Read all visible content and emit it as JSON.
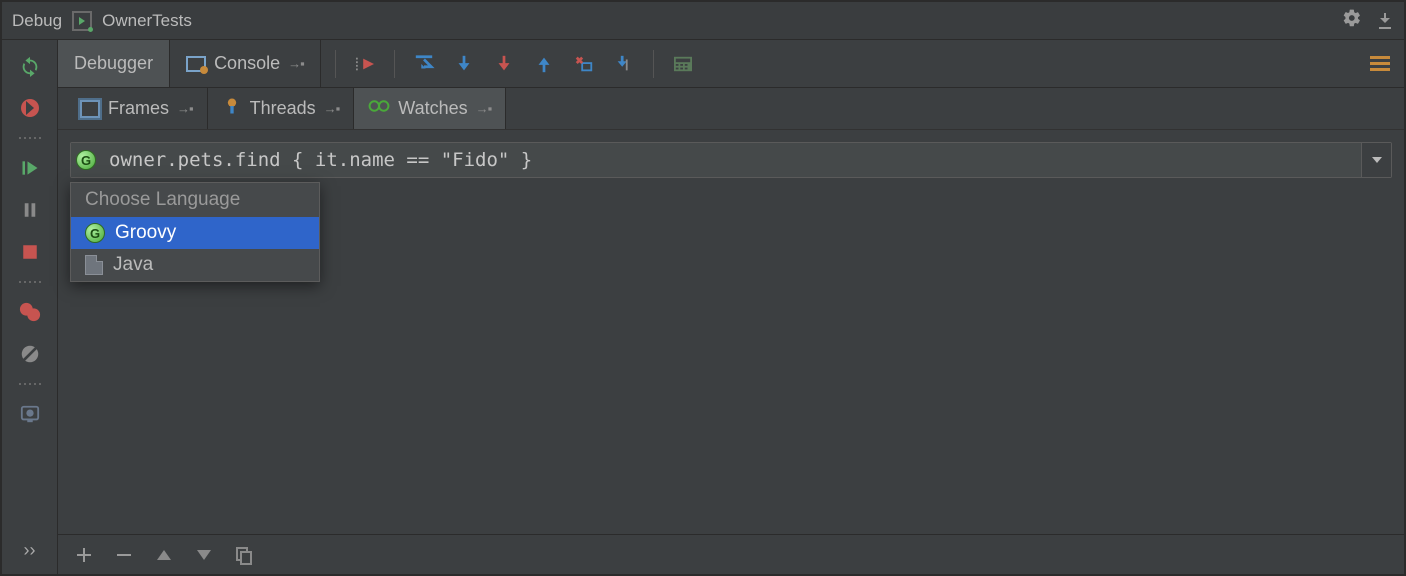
{
  "title_bar": {
    "title": "Debug",
    "config_name": "OwnerTests"
  },
  "top_tabs": {
    "debugger": "Debugger",
    "console": "Console"
  },
  "sub_tabs": {
    "frames": "Frames",
    "threads": "Threads",
    "watches": "Watches"
  },
  "watch": {
    "expression": "owner.pets.find { it.name == \"Fido\" }"
  },
  "lang_popup": {
    "header": "Choose Language",
    "groovy": "Groovy",
    "java": "Java"
  }
}
